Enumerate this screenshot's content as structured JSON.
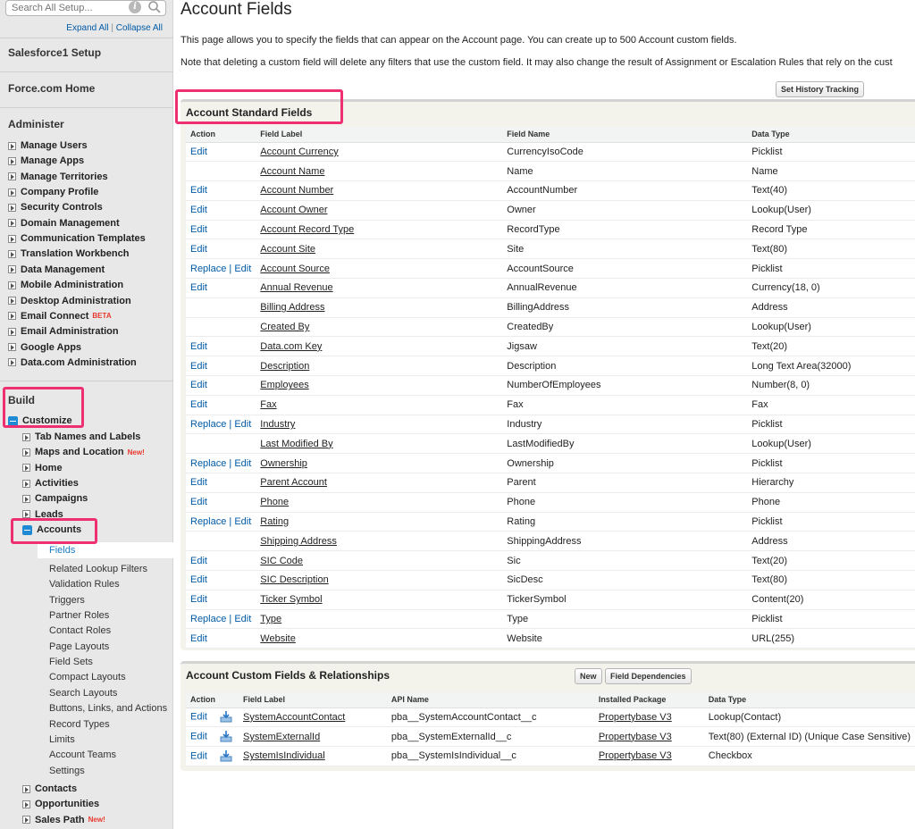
{
  "sidebar": {
    "search_placeholder": "Search All Setup...",
    "expand_all": "Expand All",
    "collapse_all": "Collapse All",
    "separator": "|",
    "salesforce1_setup": "Salesforce1 Setup",
    "force_home": "Force.com Home",
    "administer_heading": "Administer",
    "administer_items": [
      "Manage Users",
      "Manage Apps",
      "Manage Territories",
      "Company Profile",
      "Security Controls",
      "Domain Management",
      "Communication Templates",
      "Translation Workbench",
      "Data Management",
      "Mobile Administration",
      "Desktop Administration",
      "Email Connect",
      "Email Administration",
      "Google Apps",
      "Data.com Administration"
    ],
    "beta_label": "BETA",
    "build_heading": "Build",
    "customize_label": "Customize",
    "customize_items": [
      "Tab Names and Labels",
      "Maps and Location",
      "Home",
      "Activities",
      "Campaigns",
      "Leads"
    ],
    "new_label": "New!",
    "accounts_label": "Accounts",
    "accounts_subitems": [
      "Fields",
      "Related Lookup Filters",
      "Validation Rules",
      "Triggers",
      "Partner Roles",
      "Contact Roles",
      "Page Layouts",
      "Field Sets",
      "Compact Layouts",
      "Search Layouts",
      "Buttons, Links, and Actions",
      "Record Types",
      "Limits",
      "Account Teams",
      "Settings"
    ],
    "after_items": [
      "Contacts",
      "Opportunities",
      "Sales Path"
    ]
  },
  "main": {
    "title": "Account Fields",
    "desc1": "This page allows you to specify the fields that can appear on the Account page. You can create up to 500 Account custom fields.",
    "desc2": "Note that deleting a custom field will delete any filters that use the custom field. It may also change the result of Assignment or Escalation Rules that rely on the cust",
    "set_history_button": "Set History Tracking",
    "standard": {
      "title": "Account Standard Fields",
      "headers": [
        "Action",
        "Field Label",
        "Field Name",
        "Data Type"
      ],
      "rows": [
        [
          "Edit",
          "Account Currency",
          "CurrencyIsoCode",
          "Picklist"
        ],
        [
          "",
          "Account Name",
          "Name",
          "Name"
        ],
        [
          "Edit",
          "Account Number",
          "AccountNumber",
          "Text(40)"
        ],
        [
          "Edit",
          "Account Owner",
          "Owner",
          "Lookup(User)"
        ],
        [
          "Edit",
          "Account Record Type",
          "RecordType",
          "Record Type"
        ],
        [
          "Edit",
          "Account Site",
          "Site",
          "Text(80)"
        ],
        [
          "Replace | Edit",
          "Account Source",
          "AccountSource",
          "Picklist"
        ],
        [
          "Edit",
          "Annual Revenue",
          "AnnualRevenue",
          "Currency(18, 0)"
        ],
        [
          "",
          "Billing Address",
          "BillingAddress",
          "Address"
        ],
        [
          "",
          "Created By",
          "CreatedBy",
          "Lookup(User)"
        ],
        [
          "Edit",
          "Data.com Key",
          "Jigsaw",
          "Text(20)"
        ],
        [
          "Edit",
          "Description",
          "Description",
          "Long Text Area(32000)"
        ],
        [
          "Edit",
          "Employees",
          "NumberOfEmployees",
          "Number(8, 0)"
        ],
        [
          "Edit",
          "Fax",
          "Fax",
          "Fax"
        ],
        [
          "Replace | Edit",
          "Industry",
          "Industry",
          "Picklist"
        ],
        [
          "",
          "Last Modified By",
          "LastModifiedBy",
          "Lookup(User)"
        ],
        [
          "Replace | Edit",
          "Ownership",
          "Ownership",
          "Picklist"
        ],
        [
          "Edit",
          "Parent Account",
          "Parent",
          "Hierarchy"
        ],
        [
          "Edit",
          "Phone",
          "Phone",
          "Phone"
        ],
        [
          "Replace | Edit",
          "Rating",
          "Rating",
          "Picklist"
        ],
        [
          "",
          "Shipping Address",
          "ShippingAddress",
          "Address"
        ],
        [
          "Edit",
          "SIC Code",
          "Sic",
          "Text(20)"
        ],
        [
          "Edit",
          "SIC Description",
          "SicDesc",
          "Text(80)"
        ],
        [
          "Edit",
          "Ticker Symbol",
          "TickerSymbol",
          "Content(20)"
        ],
        [
          "Replace | Edit",
          "Type",
          "Type",
          "Picklist"
        ],
        [
          "Edit",
          "Website",
          "Website",
          "URL(255)"
        ]
      ]
    },
    "custom": {
      "title": "Account Custom Fields & Relationships",
      "new_button": "New",
      "deps_button": "Field Dependencies",
      "headers": [
        "Action",
        "Field Label",
        "API Name",
        "Installed Package",
        "Data Type"
      ],
      "rows": [
        [
          "Edit",
          "SystemAccountContact",
          "pba__SystemAccountContact__c",
          "Propertybase V3",
          "Lookup(Contact)"
        ],
        [
          "Edit",
          "SystemExternalId",
          "pba__SystemExternalId__c",
          "Propertybase V3",
          "Text(80) (External ID) (Unique Case Sensitive)"
        ],
        [
          "Edit",
          "SystemIsIndividual",
          "pba__SystemIsIndividual__c",
          "Propertybase V3",
          "Checkbox"
        ]
      ]
    }
  },
  "colors": {
    "highlight": "#ee2f72",
    "link": "#015ba7",
    "badge": "#e8392d"
  }
}
